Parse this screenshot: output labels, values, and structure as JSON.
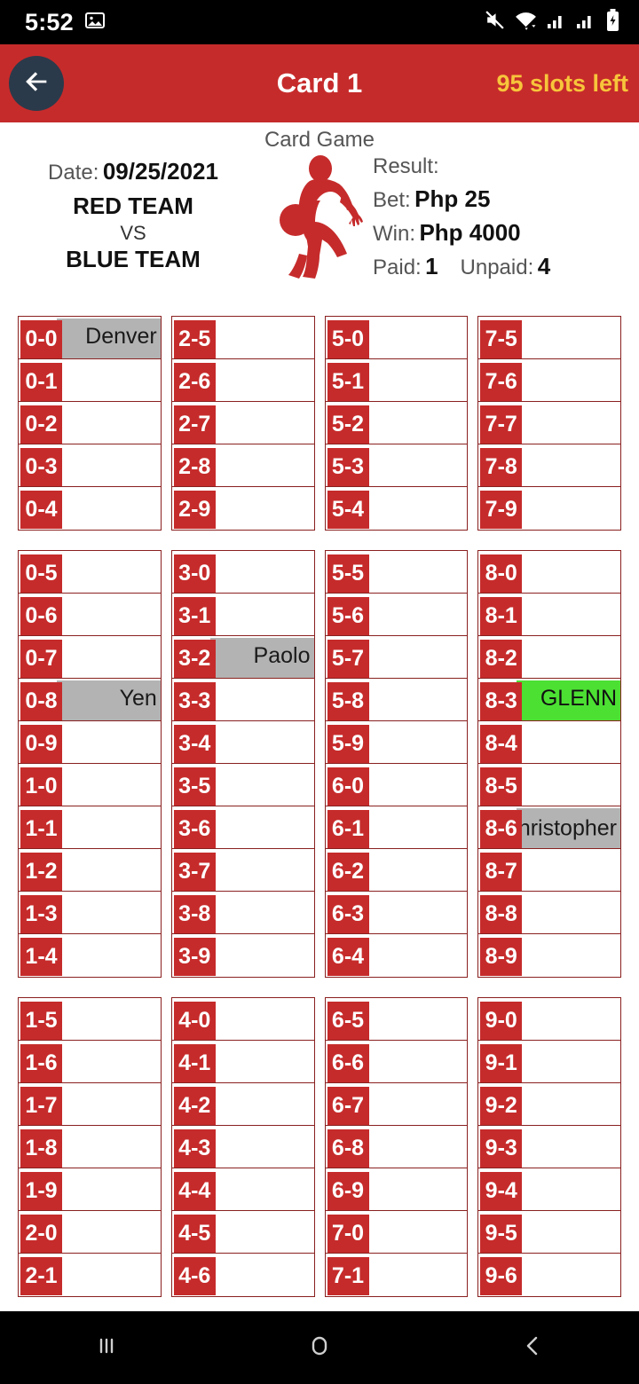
{
  "status_bar": {
    "time": "5:52",
    "icons": [
      "image-icon",
      "mute-icon",
      "wifi-icon",
      "signal-icon",
      "signal-icon",
      "battery-charging-icon"
    ]
  },
  "app_bar": {
    "back_label": "back-arrow",
    "title": "Card 1",
    "slots_left": "95 slots left",
    "background": "#C62B2B",
    "slots_color": "#F7C53B"
  },
  "info": {
    "date_label": "Date:",
    "date_value": "09/25/2021",
    "team_a": "RED TEAM",
    "vs": "VS",
    "team_b": "BLUE TEAM",
    "game_title": "Card Game",
    "result_label": "Result:",
    "bet_label": "Bet:",
    "bet_value": "Php 25",
    "win_label": "Win:",
    "win_value": "Php 4000",
    "paid_label": "Paid:",
    "paid_value": "1",
    "unpaid_label": "Unpaid:",
    "unpaid_value": "4"
  },
  "legend": {
    "empty_color": "#FFFFFF",
    "taken_color": "#B3B3B3",
    "paid_color": "#4CE033",
    "code_color": "#C62B2B"
  },
  "blocks": [
    {
      "columns": [
        [
          {
            "code": "0-0",
            "owner": "Denver",
            "state": "taken"
          },
          {
            "code": "0-1",
            "owner": "",
            "state": "empty"
          },
          {
            "code": "0-2",
            "owner": "",
            "state": "empty"
          },
          {
            "code": "0-3",
            "owner": "",
            "state": "empty"
          },
          {
            "code": "0-4",
            "owner": "",
            "state": "empty"
          }
        ],
        [
          {
            "code": "2-5",
            "owner": "",
            "state": "empty"
          },
          {
            "code": "2-6",
            "owner": "",
            "state": "empty"
          },
          {
            "code": "2-7",
            "owner": "",
            "state": "empty"
          },
          {
            "code": "2-8",
            "owner": "",
            "state": "empty"
          },
          {
            "code": "2-9",
            "owner": "",
            "state": "empty"
          }
        ],
        [
          {
            "code": "5-0",
            "owner": "",
            "state": "empty"
          },
          {
            "code": "5-1",
            "owner": "",
            "state": "empty"
          },
          {
            "code": "5-2",
            "owner": "",
            "state": "empty"
          },
          {
            "code": "5-3",
            "owner": "",
            "state": "empty"
          },
          {
            "code": "5-4",
            "owner": "",
            "state": "empty"
          }
        ],
        [
          {
            "code": "7-5",
            "owner": "",
            "state": "empty"
          },
          {
            "code": "7-6",
            "owner": "",
            "state": "empty"
          },
          {
            "code": "7-7",
            "owner": "",
            "state": "empty"
          },
          {
            "code": "7-8",
            "owner": "",
            "state": "empty"
          },
          {
            "code": "7-9",
            "owner": "",
            "state": "empty"
          }
        ]
      ]
    },
    {
      "columns": [
        [
          {
            "code": "0-5",
            "owner": "",
            "state": "empty"
          },
          {
            "code": "0-6",
            "owner": "",
            "state": "empty"
          },
          {
            "code": "0-7",
            "owner": "",
            "state": "empty"
          },
          {
            "code": "0-8",
            "owner": "Yen",
            "state": "taken"
          },
          {
            "code": "0-9",
            "owner": "",
            "state": "empty"
          },
          {
            "code": "1-0",
            "owner": "",
            "state": "empty"
          },
          {
            "code": "1-1",
            "owner": "",
            "state": "empty"
          },
          {
            "code": "1-2",
            "owner": "",
            "state": "empty"
          },
          {
            "code": "1-3",
            "owner": "",
            "state": "empty"
          },
          {
            "code": "1-4",
            "owner": "",
            "state": "empty"
          }
        ],
        [
          {
            "code": "3-0",
            "owner": "",
            "state": "empty"
          },
          {
            "code": "3-1",
            "owner": "",
            "state": "empty"
          },
          {
            "code": "3-2",
            "owner": "Paolo",
            "state": "taken"
          },
          {
            "code": "3-3",
            "owner": "",
            "state": "empty"
          },
          {
            "code": "3-4",
            "owner": "",
            "state": "empty"
          },
          {
            "code": "3-5",
            "owner": "",
            "state": "empty"
          },
          {
            "code": "3-6",
            "owner": "",
            "state": "empty"
          },
          {
            "code": "3-7",
            "owner": "",
            "state": "empty"
          },
          {
            "code": "3-8",
            "owner": "",
            "state": "empty"
          },
          {
            "code": "3-9",
            "owner": "",
            "state": "empty"
          }
        ],
        [
          {
            "code": "5-5",
            "owner": "",
            "state": "empty"
          },
          {
            "code": "5-6",
            "owner": "",
            "state": "empty"
          },
          {
            "code": "5-7",
            "owner": "",
            "state": "empty"
          },
          {
            "code": "5-8",
            "owner": "",
            "state": "empty"
          },
          {
            "code": "5-9",
            "owner": "",
            "state": "empty"
          },
          {
            "code": "6-0",
            "owner": "",
            "state": "empty"
          },
          {
            "code": "6-1",
            "owner": "",
            "state": "empty"
          },
          {
            "code": "6-2",
            "owner": "",
            "state": "empty"
          },
          {
            "code": "6-3",
            "owner": "",
            "state": "empty"
          },
          {
            "code": "6-4",
            "owner": "",
            "state": "empty"
          }
        ],
        [
          {
            "code": "8-0",
            "owner": "",
            "state": "empty"
          },
          {
            "code": "8-1",
            "owner": "",
            "state": "empty"
          },
          {
            "code": "8-2",
            "owner": "",
            "state": "empty"
          },
          {
            "code": "8-3",
            "owner": "GLENN",
            "state": "paid"
          },
          {
            "code": "8-4",
            "owner": "",
            "state": "empty"
          },
          {
            "code": "8-5",
            "owner": "",
            "state": "empty"
          },
          {
            "code": "8-6",
            "owner": "Christopher",
            "state": "taken"
          },
          {
            "code": "8-7",
            "owner": "",
            "state": "empty"
          },
          {
            "code": "8-8",
            "owner": "",
            "state": "empty"
          },
          {
            "code": "8-9",
            "owner": "",
            "state": "empty"
          }
        ]
      ]
    },
    {
      "columns": [
        [
          {
            "code": "1-5",
            "owner": "",
            "state": "empty"
          },
          {
            "code": "1-6",
            "owner": "",
            "state": "empty"
          },
          {
            "code": "1-7",
            "owner": "",
            "state": "empty"
          },
          {
            "code": "1-8",
            "owner": "",
            "state": "empty"
          },
          {
            "code": "1-9",
            "owner": "",
            "state": "empty"
          },
          {
            "code": "2-0",
            "owner": "",
            "state": "empty"
          },
          {
            "code": "2-1",
            "owner": "",
            "state": "empty"
          }
        ],
        [
          {
            "code": "4-0",
            "owner": "",
            "state": "empty"
          },
          {
            "code": "4-1",
            "owner": "",
            "state": "empty"
          },
          {
            "code": "4-2",
            "owner": "",
            "state": "empty"
          },
          {
            "code": "4-3",
            "owner": "",
            "state": "empty"
          },
          {
            "code": "4-4",
            "owner": "",
            "state": "empty"
          },
          {
            "code": "4-5",
            "owner": "",
            "state": "empty"
          },
          {
            "code": "4-6",
            "owner": "",
            "state": "empty"
          }
        ],
        [
          {
            "code": "6-5",
            "owner": "",
            "state": "empty"
          },
          {
            "code": "6-6",
            "owner": "",
            "state": "empty"
          },
          {
            "code": "6-7",
            "owner": "",
            "state": "empty"
          },
          {
            "code": "6-8",
            "owner": "",
            "state": "empty"
          },
          {
            "code": "6-9",
            "owner": "",
            "state": "empty"
          },
          {
            "code": "7-0",
            "owner": "",
            "state": "empty"
          },
          {
            "code": "7-1",
            "owner": "",
            "state": "empty"
          }
        ],
        [
          {
            "code": "9-0",
            "owner": "",
            "state": "empty"
          },
          {
            "code": "9-1",
            "owner": "",
            "state": "empty"
          },
          {
            "code": "9-2",
            "owner": "",
            "state": "empty"
          },
          {
            "code": "9-3",
            "owner": "",
            "state": "empty"
          },
          {
            "code": "9-4",
            "owner": "",
            "state": "empty"
          },
          {
            "code": "9-5",
            "owner": "",
            "state": "empty"
          },
          {
            "code": "9-6",
            "owner": "",
            "state": "empty"
          }
        ]
      ]
    }
  ],
  "nav_bar": {
    "recents": "recents-icon",
    "home": "home-icon",
    "back": "back-icon"
  }
}
